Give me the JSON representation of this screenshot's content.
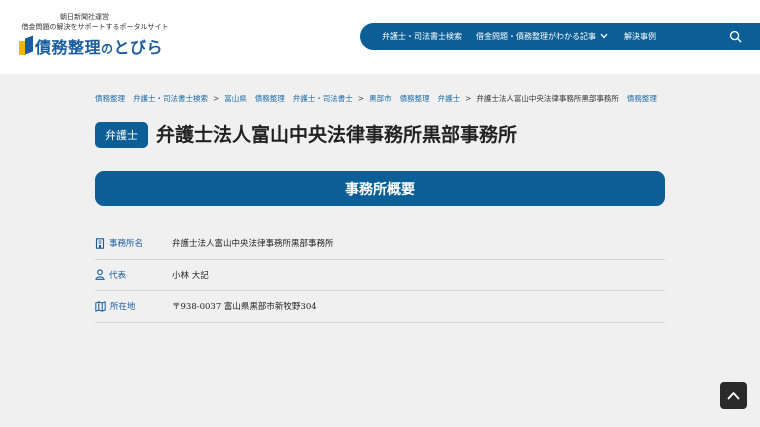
{
  "header": {
    "publisher": "朝日新聞社運営",
    "tagline": "借金問題の解決をサポートするポータルサイト",
    "logo_main": "債務整理",
    "logo_no": "の",
    "logo_end": "とびら"
  },
  "nav": {
    "items": [
      {
        "label": "弁護士・司法書士検索"
      },
      {
        "label": "借金問題・債務整理がわかる記事",
        "has_dropdown": true
      },
      {
        "label": "解決事例"
      }
    ],
    "search_icon": "search-icon"
  },
  "breadcrumb": {
    "items": [
      "債務整理",
      "弁護士・司法書士検索",
      "富山県",
      "債務整理",
      "弁護士・司法書士",
      "黒部市",
      "債務整理",
      "弁護士"
    ],
    "current": "弁護士法人富山中央法律事務所黒部事務所",
    "overflow": "債務整理"
  },
  "page": {
    "badge": "弁護士",
    "title": "弁護士法人富山中央法律事務所黒部事務所"
  },
  "section": {
    "heading": "事務所概要"
  },
  "info": {
    "rows": [
      {
        "icon": "office-icon",
        "label": "事務所名",
        "value": "弁護士法人富山中央法律事務所黒部事務所"
      },
      {
        "icon": "person-icon",
        "label": "代表",
        "value": "小林 大記"
      },
      {
        "icon": "map-icon",
        "label": "所在地",
        "value": "〒938-0037 富山県黒部市新牧野304"
      }
    ]
  },
  "scroll_top_icon": "chevron-up-icon",
  "colors": {
    "primary": "#0c5f96",
    "logo_blue": "#1a5c9e",
    "logo_yellow": "#f2b705",
    "background": "#f0f0f0"
  }
}
